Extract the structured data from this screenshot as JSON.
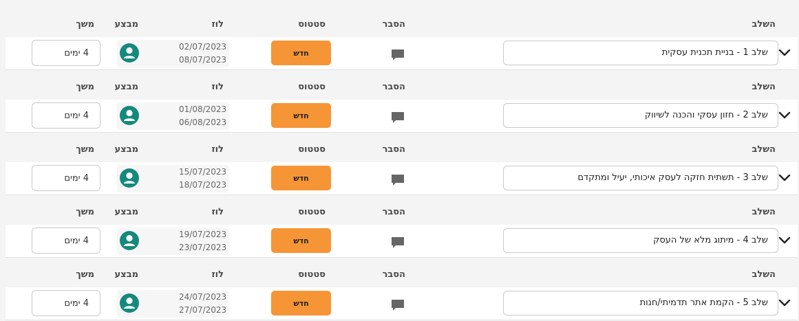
{
  "headers": {
    "step": "השלב",
    "explanation": "הסבר",
    "status": "סטטוס",
    "schedule": "לוז",
    "performer": "מבצע",
    "duration": "משך"
  },
  "stages": [
    {
      "title": "שלב 1 - בניית תכנית עסקית",
      "status": "חדש",
      "start": "02/07/2023",
      "end": "08/07/2023",
      "duration": "4 ימים"
    },
    {
      "title": "שלב 2 - חזון עסקי והכנה לשיווק",
      "status": "חדש",
      "start": "01/08/2023",
      "end": "06/08/2023",
      "duration": "4 ימים"
    },
    {
      "title": "שלב 3 - תשתית חזקה לעסק איכותי, יעיל ומתקדם",
      "status": "חדש",
      "start": "15/07/2023",
      "end": "18/07/2023",
      "duration": "4 ימים"
    },
    {
      "title": "שלב 4 - מיתוג מלא של העסק",
      "status": "חדש",
      "start": "19/07/2023",
      "end": "23/07/2023",
      "duration": "4 ימים"
    },
    {
      "title": "שלב 5 - הקמת אתר תדמיתי/חנות",
      "status": "חדש",
      "start": "24/07/2023",
      "end": "27/07/2023",
      "duration": "4 ימים"
    }
  ],
  "colors": {
    "status_new": "#f69536",
    "avatar": "#15897e",
    "comment_icon": "#666666"
  },
  "icons": {
    "expand": "chevron-down-icon",
    "comment": "comment-icon",
    "performer": "user-avatar-icon"
  }
}
